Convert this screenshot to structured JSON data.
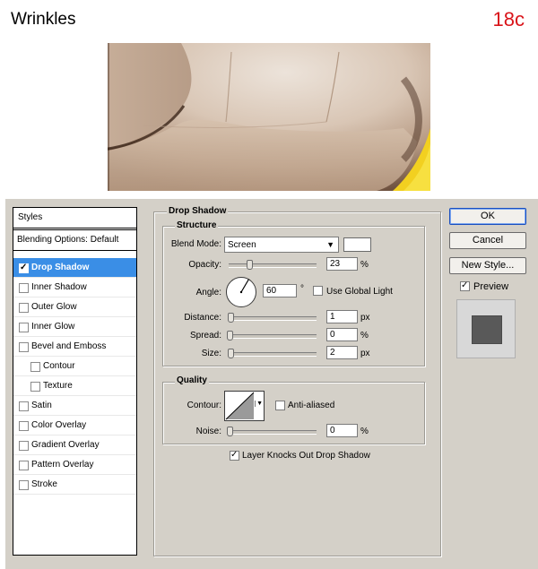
{
  "header": {
    "title": "Wrinkles",
    "step": "18c"
  },
  "styles_panel": {
    "heading": "Styles",
    "blending_options": "Blending Options: Default",
    "items": [
      {
        "label": "Drop Shadow",
        "checked": true,
        "selected": true,
        "indent": false
      },
      {
        "label": "Inner Shadow",
        "checked": false,
        "selected": false,
        "indent": false
      },
      {
        "label": "Outer Glow",
        "checked": false,
        "selected": false,
        "indent": false
      },
      {
        "label": "Inner Glow",
        "checked": false,
        "selected": false,
        "indent": false
      },
      {
        "label": "Bevel and Emboss",
        "checked": false,
        "selected": false,
        "indent": false
      },
      {
        "label": "Contour",
        "checked": false,
        "selected": false,
        "indent": true
      },
      {
        "label": "Texture",
        "checked": false,
        "selected": false,
        "indent": true
      },
      {
        "label": "Satin",
        "checked": false,
        "selected": false,
        "indent": false
      },
      {
        "label": "Color Overlay",
        "checked": false,
        "selected": false,
        "indent": false
      },
      {
        "label": "Gradient Overlay",
        "checked": false,
        "selected": false,
        "indent": false
      },
      {
        "label": "Pattern Overlay",
        "checked": false,
        "selected": false,
        "indent": false
      },
      {
        "label": "Stroke",
        "checked": false,
        "selected": false,
        "indent": false
      }
    ]
  },
  "drop_shadow": {
    "title": "Drop Shadow",
    "structure": {
      "title": "Structure",
      "blend_mode_label": "Blend Mode:",
      "blend_mode_value": "Screen",
      "shadow_color": "#ffffff",
      "opacity_label": "Opacity:",
      "opacity_value": "23",
      "opacity_unit": "%",
      "opacity_fraction": 0.23,
      "angle_label": "Angle:",
      "angle_value": "60",
      "angle_unit": "°",
      "use_global_light_label": "Use Global Light",
      "use_global_light_checked": false,
      "distance_label": "Distance:",
      "distance_value": "1",
      "distance_unit": "px",
      "spread_label": "Spread:",
      "spread_value": "0",
      "spread_unit": "%",
      "size_label": "Size:",
      "size_value": "2",
      "size_unit": "px"
    },
    "quality": {
      "title": "Quality",
      "contour_label": "Contour:",
      "anti_aliased_label": "Anti-aliased",
      "anti_aliased_checked": false,
      "noise_label": "Noise:",
      "noise_value": "0",
      "noise_unit": "%"
    },
    "knockout_label": "Layer Knocks Out Drop Shadow",
    "knockout_checked": true
  },
  "buttons": {
    "ok": "OK",
    "cancel": "Cancel",
    "new_style": "New Style...",
    "preview_label": "Preview",
    "preview_checked": true
  },
  "colors": {
    "selection": "#3a8ee6",
    "step_red": "#d9141a",
    "dialog_bg": "#d4d0c8"
  }
}
